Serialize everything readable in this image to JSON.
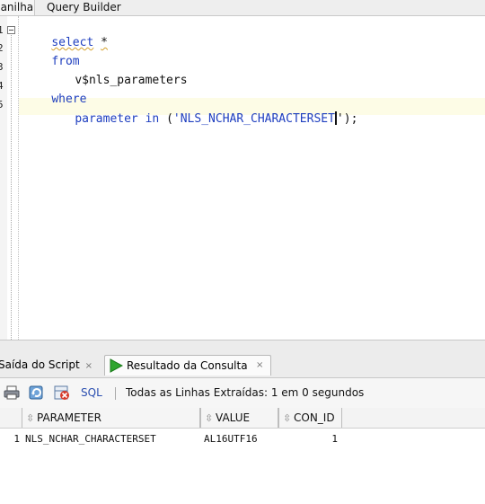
{
  "editor_tabs": {
    "worksheet": "Planilha",
    "query_builder": "Query Builder"
  },
  "editor": {
    "line_numbers": [
      "1",
      "2",
      "3",
      "4",
      "5"
    ],
    "lines": {
      "l1_kw": "select",
      "l1_rest": "*",
      "l2_kw": "from",
      "l3_text": "v$nls_parameters",
      "l4_kw": "where",
      "l5_kw1": "parameter",
      "l5_kw2": "in",
      "l5_open": "(",
      "l5_str": "'NLS_NCHAR_CHARACTERSET",
      "l5_close": "');"
    }
  },
  "result_tabs": {
    "script_output": "Saída do Script",
    "query_result": "Resultado da Consulta",
    "close": "×"
  },
  "toolbar": {
    "sql_label": "SQL",
    "status": "Todas as Linhas Extraídas: 1 em 0 segundos",
    "icons": [
      "print-icon",
      "refresh-icon",
      "delete-icon"
    ]
  },
  "grid": {
    "columns": [
      "PARAMETER",
      "VALUE",
      "CON_ID"
    ],
    "rows": [
      {
        "num": "1",
        "parameter": "NLS_NCHAR_CHARACTERSET",
        "value": "AL16UTF16",
        "con_id": "1"
      }
    ]
  },
  "colors": {
    "keyword": "#1f3fbf",
    "current_line": "#fdfce6",
    "run_icon": "#2fa52f",
    "link": "#2a4eb0"
  }
}
